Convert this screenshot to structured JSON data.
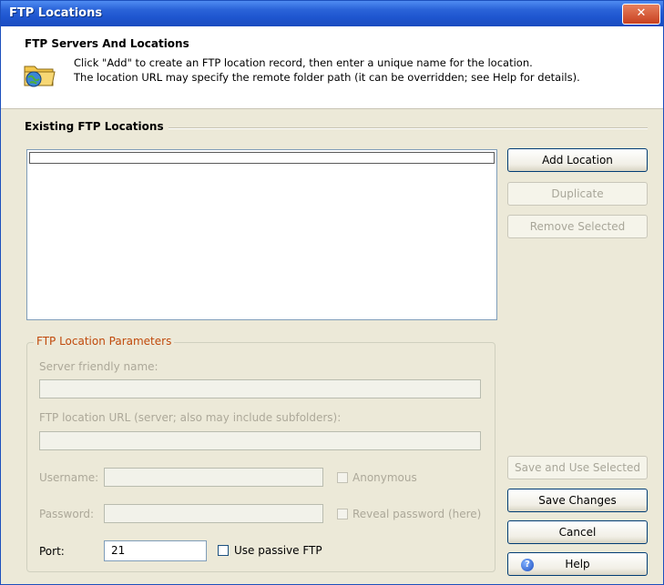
{
  "window": {
    "title": "FTP Locations",
    "close_glyph": "✕"
  },
  "header": {
    "title": "FTP Servers And Locations",
    "line1": "Click \"Add\" to create an FTP location record, then enter a unique name for the location.",
    "line2": "The location URL may specify the remote folder path (it can be overridden; see Help for details).",
    "icon": "ftp-folder-globe-icon"
  },
  "existing": {
    "label": "Existing FTP Locations",
    "items": []
  },
  "buttons": {
    "add": "Add Location",
    "duplicate": "Duplicate",
    "remove": "Remove Selected",
    "save_use": "Save and Use Selected",
    "save_changes": "Save Changes",
    "cancel": "Cancel",
    "help": "Help"
  },
  "params": {
    "legend": "FTP Location Parameters",
    "server_name_label": "Server friendly name:",
    "server_name_value": "",
    "url_label": "FTP location URL (server; also may include subfolders):",
    "url_value": "",
    "username_label": "Username:",
    "username_value": "",
    "anonymous_label": "Anonymous",
    "anonymous_checked": false,
    "password_label": "Password:",
    "password_value": "",
    "reveal_label": "Reveal password (here)",
    "reveal_checked": false,
    "port_label": "Port:",
    "port_value": "21",
    "passive_label": "Use passive FTP",
    "passive_checked": false
  },
  "colors": {
    "titlebar": "#245edb",
    "legend": "#c04a0c",
    "disabled_text": "#aca899"
  }
}
